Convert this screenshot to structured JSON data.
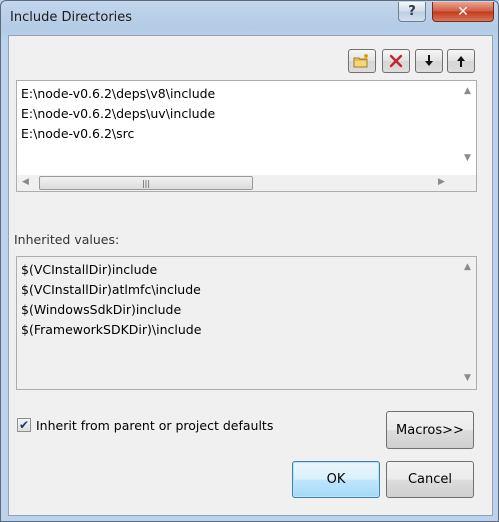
{
  "window": {
    "title": "Include Directories"
  },
  "titlebar": {
    "help_symbol": "?",
    "close_symbol": "✕"
  },
  "toolbar": {
    "new_line_icon": "new-folder-icon",
    "delete_icon": "delete-x-icon",
    "move_down_icon": "arrow-down-icon",
    "move_up_icon": "arrow-up-icon"
  },
  "directories": {
    "items": [
      "E:\\node-v0.6.2\\deps\\v8\\include",
      "E:\\node-v0.6.2\\deps\\uv\\include",
      "E:\\node-v0.6.2\\src"
    ]
  },
  "inherited": {
    "label": "Inherited values:",
    "items": [
      "$(VCInstallDir)include",
      "$(VCInstallDir)atlmfc\\include",
      "$(WindowsSdkDir)include",
      "$(FrameworkSDKDir)\\include"
    ]
  },
  "inherit_checkbox": {
    "label": "Inherit from parent or project defaults",
    "checked": true
  },
  "buttons": {
    "macros": "Macros>>",
    "ok": "OK",
    "cancel": "Cancel"
  },
  "colors": {
    "accent": "#3c7fb1",
    "delete_red": "#c0272d",
    "title_bar": "#b9d1ea"
  }
}
